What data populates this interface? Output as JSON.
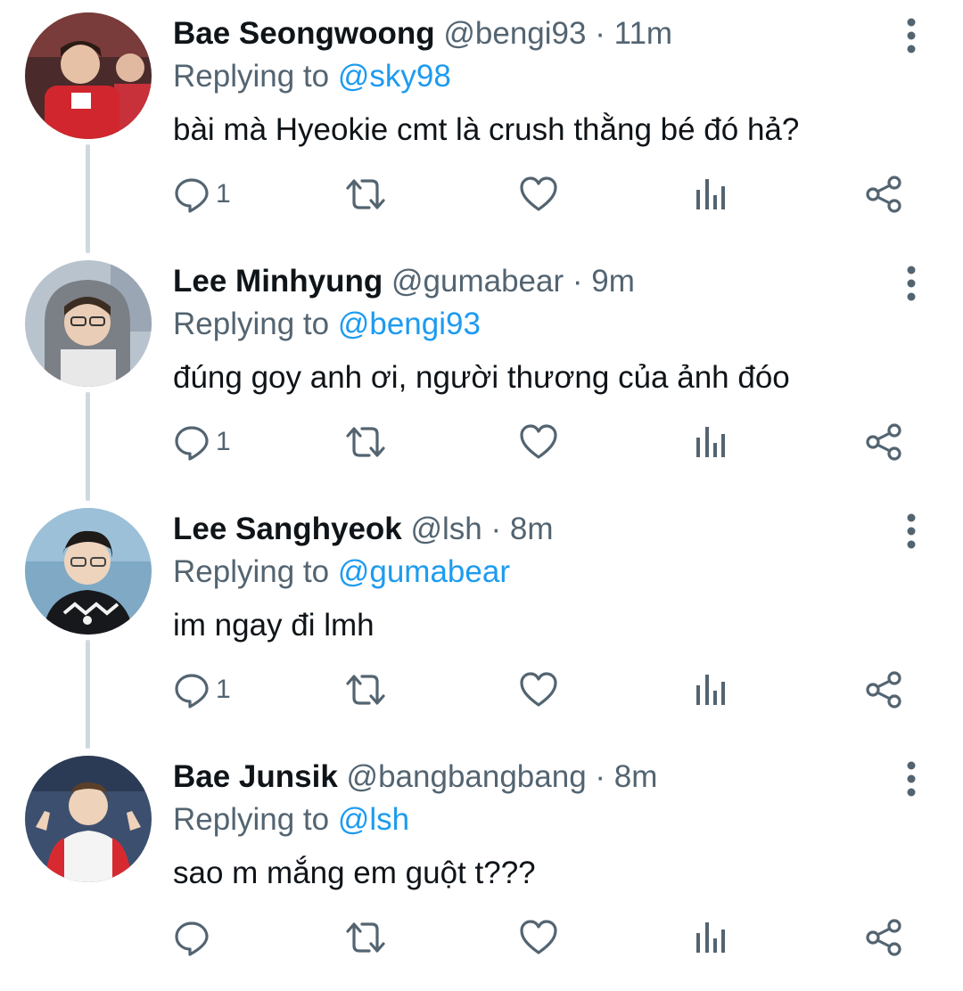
{
  "colors": {
    "link": "#1d9bf0",
    "secondary": "#536471",
    "text": "#0f1419",
    "thread_line": "#cfd9de"
  },
  "icons": {
    "reply": "reply-icon",
    "retweet": "retweet-icon",
    "like": "heart-icon",
    "analytics": "analytics-icon",
    "share": "share-icon",
    "more": "more-options-icon"
  },
  "tweets": [
    {
      "name": "Bae Seongwoong",
      "handle": "@bengi93",
      "dot": "·",
      "time": "11m",
      "replying_prefix": "Replying to",
      "replying_to": "@sky98",
      "text": "bài mà Hyeokie cmt là crush thằng bé đó hả?",
      "reply_count": "1"
    },
    {
      "name": "Lee Minhyung",
      "handle": "@gumabear",
      "dot": "·",
      "time": "9m",
      "replying_prefix": "Replying to",
      "replying_to": "@bengi93",
      "text": "đúng goy anh ơi, người thương của ảnh đóo",
      "reply_count": "1"
    },
    {
      "name": "Lee Sanghyeok",
      "handle": "@lsh",
      "dot": "·",
      "time": "8m",
      "replying_prefix": "Replying to",
      "replying_to": "@gumabear",
      "text": "im ngay đi lmh",
      "reply_count": "1"
    },
    {
      "name": "Bae Junsik",
      "handle": "@bangbangbang",
      "dot": "·",
      "time": "8m",
      "replying_prefix": "Replying to",
      "replying_to": "@lsh",
      "text": "sao m mắng em guột t???",
      "reply_count": ""
    }
  ]
}
